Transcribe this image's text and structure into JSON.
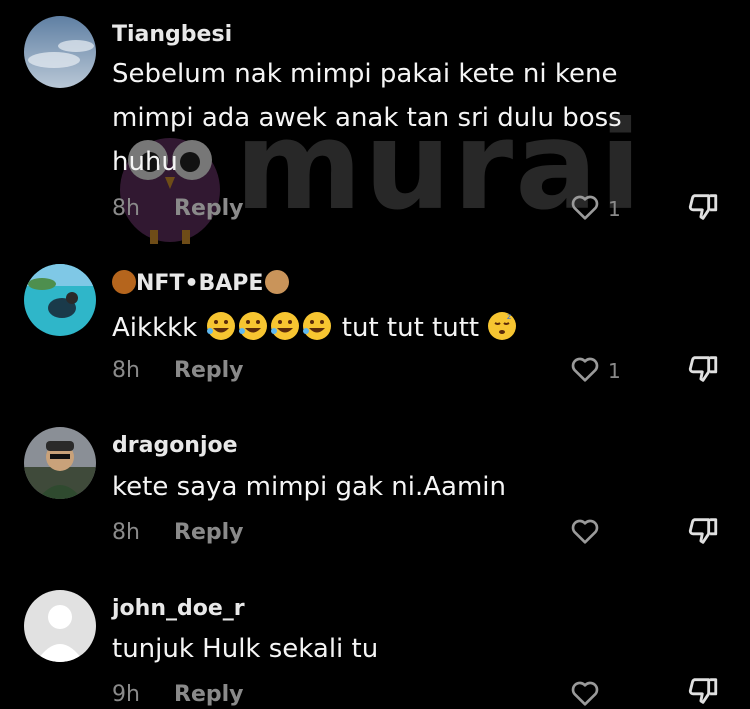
{
  "watermark": {
    "text": "murai",
    "brand_color": "#5a5a5a",
    "mascot_color": "#6b3a6b"
  },
  "comments": [
    {
      "username": "Tiangbesi",
      "text_line1": "Sebelum nak mimpi pakai kete ni kene",
      "text_line2": "mimpi ada awek anak tan sri dulu boss",
      "text_line3": "huhu",
      "time": "8h",
      "reply_label": "Reply",
      "likes": "1"
    },
    {
      "username": "NFT•BAPE",
      "text_prefix": "Aikkkk",
      "text_suffix": "tut tut tutt",
      "time": "8h",
      "reply_label": "Reply",
      "likes": "1"
    },
    {
      "username": "dragonjoe",
      "text": "kete saya mimpi gak ni.Aamin",
      "time": "8h",
      "reply_label": "Reply",
      "likes": ""
    },
    {
      "username": "john_doe_r",
      "text": "tunjuk Hulk sekali tu",
      "time": "9h",
      "reply_label": "Reply",
      "likes": ""
    }
  ],
  "colors": {
    "background": "#000000",
    "text": "#f5f5f5",
    "muted": "#8a8a8a"
  }
}
